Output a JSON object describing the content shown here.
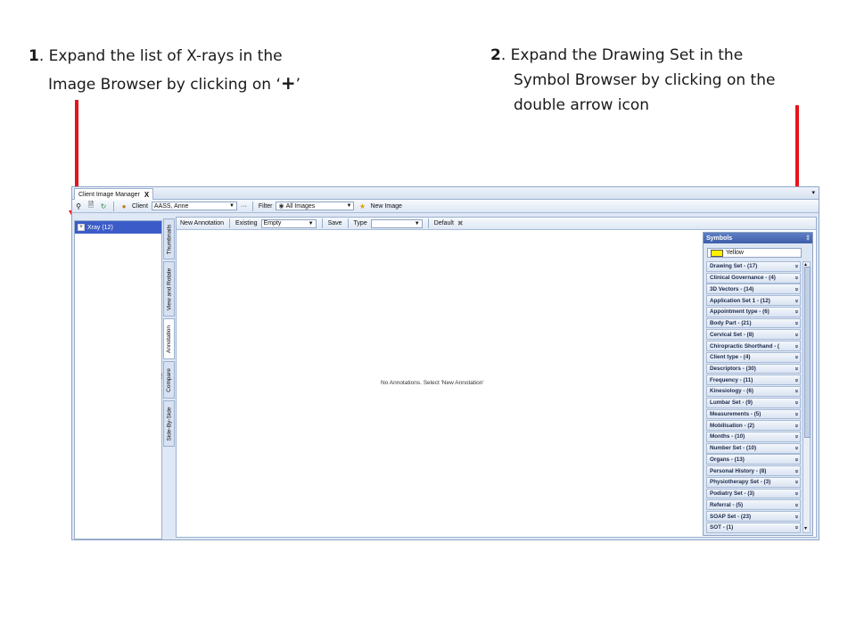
{
  "instructions": {
    "step1": {
      "num": "1",
      "line1": ". Expand the list of X-rays in the",
      "line2_pre": "Image Browser by clicking on ‘",
      "plus": "+",
      "line2_post": "’"
    },
    "step2": {
      "num": "2",
      "line1": ". Expand the Drawing Set in the",
      "line2": "Symbol Browser by clicking on the",
      "line3": "double arrow icon"
    }
  },
  "window": {
    "tab_title": "Client Image Manager",
    "close_glyph": "X",
    "menu_glyph": "▾"
  },
  "toolbar": {
    "client_label": "Client",
    "client_value": "AASS, Anne",
    "more": "···",
    "filter_label": "Filter",
    "filter_value": "All Images",
    "new_image_label": "New Image"
  },
  "image_browser": {
    "xray_label": "Xray (12)",
    "expand_glyph": "+"
  },
  "side_tabs": [
    "Thumbnails",
    "View and Rotate",
    "Annotation",
    "Compare",
    "Side-By-Side"
  ],
  "annotation_toolbar": {
    "new_annotation": "New Annotation",
    "existing_label": "Existing",
    "existing_value": "Empty",
    "save": "Save",
    "type_label": "Type",
    "type_value": "",
    "default": "Default",
    "delete_glyph": "✖"
  },
  "main": {
    "empty_message": "No Annotations. Select 'New Annotation'"
  },
  "symbols": {
    "title": "Symbols",
    "pin_glyph": "‡",
    "color_value": "Yellow",
    "expand_glyph": "»",
    "items": [
      "Drawing Set - (17)",
      "Clinical Governance - (4)",
      "3D Vectors - (14)",
      "Application Set 1 - (12)",
      "Appointment type - (6)",
      "Body Part - (21)",
      "Cervical Set - (8)",
      "Chiropractic Shorthand - (",
      "Client type - (4)",
      "Descriptors - (30)",
      "Frequency - (11)",
      "Kinesiology - (6)",
      "Lumbar Set - (9)",
      "Measurements - (5)",
      "Mobilisation - (2)",
      "Months - (10)",
      "Number Set - (10)",
      "Organs - (13)",
      "Personal History - (8)",
      "Physiotherapy Set - (3)",
      "Podiatry Set - (3)",
      "Referral - (5)",
      "SOAP Set - (23)",
      "SOT - (1)"
    ]
  },
  "colors": {
    "accent": "#3b5cc8",
    "arrow": "#e8141b",
    "swatch": "#fff200"
  }
}
